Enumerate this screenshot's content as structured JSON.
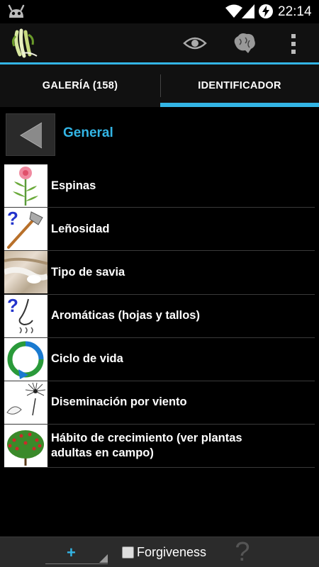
{
  "status_bar": {
    "time": "22:14",
    "icons": [
      "android-icon",
      "wifi-icon",
      "signal-icon",
      "battery-charging-icon"
    ]
  },
  "action_bar": {
    "icons": [
      "app-logo",
      "eye-icon",
      "brain-icon",
      "overflow-menu-icon"
    ]
  },
  "tabs": [
    {
      "label": "GALERÍA (158)",
      "selected": false
    },
    {
      "label": "IDENTIFICADOR",
      "selected": true
    }
  ],
  "category": {
    "title": "General",
    "back_icon": "back-arrow-icon"
  },
  "list": {
    "items": [
      {
        "label": "Espinas",
        "icon": "flower-plant-icon"
      },
      {
        "label": "Leñosidad",
        "icon": "axe-question-icon"
      },
      {
        "label": "Tipo de savia",
        "icon": "sap-photo-icon"
      },
      {
        "label": "Aromáticas (hojas y tallos)",
        "icon": "nose-question-icon"
      },
      {
        "label": "Ciclo de vida",
        "icon": "cycle-arrow-icon"
      },
      {
        "label": "Diseminación por viento",
        "icon": "wind-seed-icon"
      },
      {
        "label": "Hábito de crecimiento (ver plantas adultas en campo)",
        "icon": "tree-icon"
      }
    ]
  },
  "bottom_bar": {
    "add_label": "+",
    "forgiveness_label": "Forgiveness",
    "forgiveness_checked": false,
    "help_label": "?"
  },
  "colors": {
    "accent": "#33b5e5",
    "background": "#000000",
    "bar": "#111111"
  }
}
